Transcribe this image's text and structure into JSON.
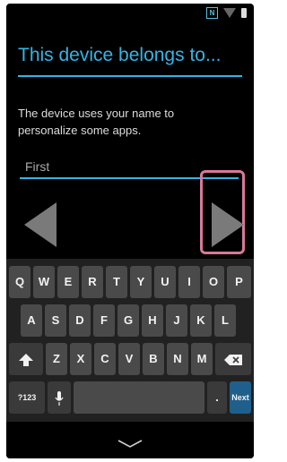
{
  "status_bar": {
    "icons": [
      "nfc-icon",
      "wifi-icon",
      "battery-icon"
    ],
    "nfc_label": "N"
  },
  "screen": {
    "title": "This device belongs to...",
    "description": "The device uses your name to personalize some apps.",
    "first_name_field": {
      "placeholder": "First",
      "value": ""
    }
  },
  "navigation": {
    "prev_icon": "left-triangle-icon",
    "next_icon": "right-triangle-icon",
    "highlight_color": "#d8789b"
  },
  "keyboard": {
    "row1": [
      "Q",
      "W",
      "E",
      "R",
      "T",
      "Y",
      "U",
      "I",
      "O",
      "P"
    ],
    "row2": [
      "A",
      "S",
      "D",
      "F",
      "G",
      "H",
      "J",
      "K",
      "L"
    ],
    "row3": [
      "Z",
      "X",
      "C",
      "V",
      "B",
      "N",
      "M"
    ],
    "sym_key_label": "?123",
    "period_key_label": ".",
    "next_key_label": "Next"
  },
  "accent_color": "#33b5e5"
}
